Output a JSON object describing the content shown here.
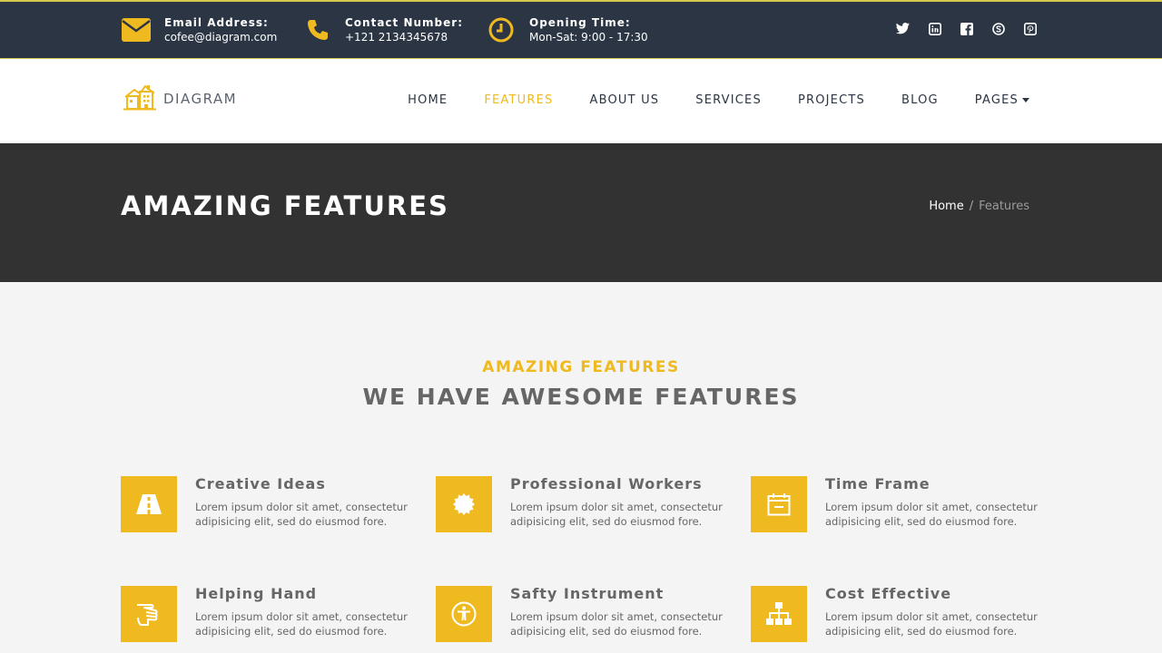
{
  "topbar": {
    "email": {
      "label": "Email Address:",
      "value": "cofee@diagram.com",
      "icon": "envelope-icon"
    },
    "phone": {
      "label": "Contact Number:",
      "value": "+121 2134345678",
      "icon": "phone-icon"
    },
    "hours": {
      "label": "Opening Time:",
      "value": "Mon-Sat: 9:00 - 17:30",
      "icon": "clock-icon"
    },
    "social": [
      "twitter-icon",
      "linkedin-icon",
      "facebook-icon",
      "skype-icon",
      "pinterest-icon"
    ]
  },
  "brand": {
    "name": "DIAGRAM",
    "accent": "#efb920"
  },
  "nav": {
    "home": "HOME",
    "features": "FEATURES",
    "about": "ABOUT US",
    "services": "SERVICES",
    "projects": "PROJECTS",
    "blog": "BLOG",
    "pages": "PAGES"
  },
  "hero": {
    "title": "AMAZING FEATURES",
    "breadcrumb": {
      "home": "Home",
      "separator": "/",
      "current": "Features"
    }
  },
  "section": {
    "subtitle": "AMAZING FEATURES",
    "title": "WE HAVE AWESOME FEATURES"
  },
  "features": [
    {
      "title": "Creative Ideas",
      "desc": "Lorem ipsum dolor sit amet, consectetur adipisicing elit, sed do eiusmod fore.",
      "icon": "road-icon"
    },
    {
      "title": "Professional Workers",
      "desc": "Lorem ipsum dolor sit amet, consectetur adipisicing elit, sed do eiusmod fore.",
      "icon": "badge-icon"
    },
    {
      "title": "Time Frame",
      "desc": "Lorem ipsum dolor sit amet, consectetur adipisicing elit, sed do eiusmod fore.",
      "icon": "calendar-icon"
    },
    {
      "title": "Helping Hand",
      "desc": "Lorem ipsum dolor sit amet, consectetur adipisicing elit, sed do eiusmod fore.",
      "icon": "hand-icon"
    },
    {
      "title": "Safty Instrument",
      "desc": "Lorem ipsum dolor sit amet, consectetur adipisicing elit, sed do eiusmod fore.",
      "icon": "accessibility-icon"
    },
    {
      "title": "Cost Effective",
      "desc": "Lorem ipsum dolor sit amet, consectetur adipisicing elit, sed do eiusmod fore.",
      "icon": "sitemap-icon"
    }
  ]
}
